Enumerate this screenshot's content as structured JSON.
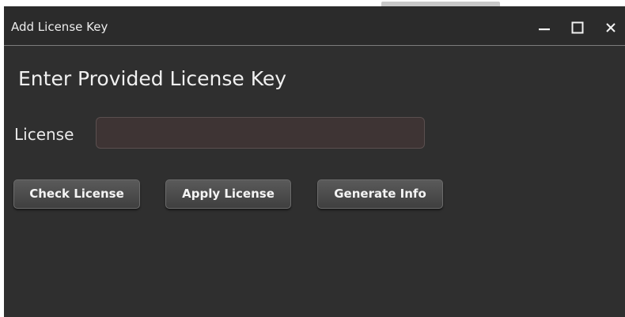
{
  "window": {
    "title": "Add License Key",
    "controls": {
      "minimize_icon": "minimize-icon",
      "maximize_icon": "maximize-icon",
      "close_icon": "close-icon"
    }
  },
  "main": {
    "heading": "Enter Provided License Key",
    "license": {
      "label": "License",
      "value": "",
      "placeholder": ""
    },
    "buttons": {
      "check": "Check License",
      "apply": "Apply License",
      "generate": "Generate Info"
    }
  },
  "colors": {
    "window_background": "#2f2f2f",
    "titlebar_background": "#2b2b2b",
    "input_background": "#3e3434",
    "button_background": "#4a4a4a",
    "text": "#f0f0f0"
  }
}
